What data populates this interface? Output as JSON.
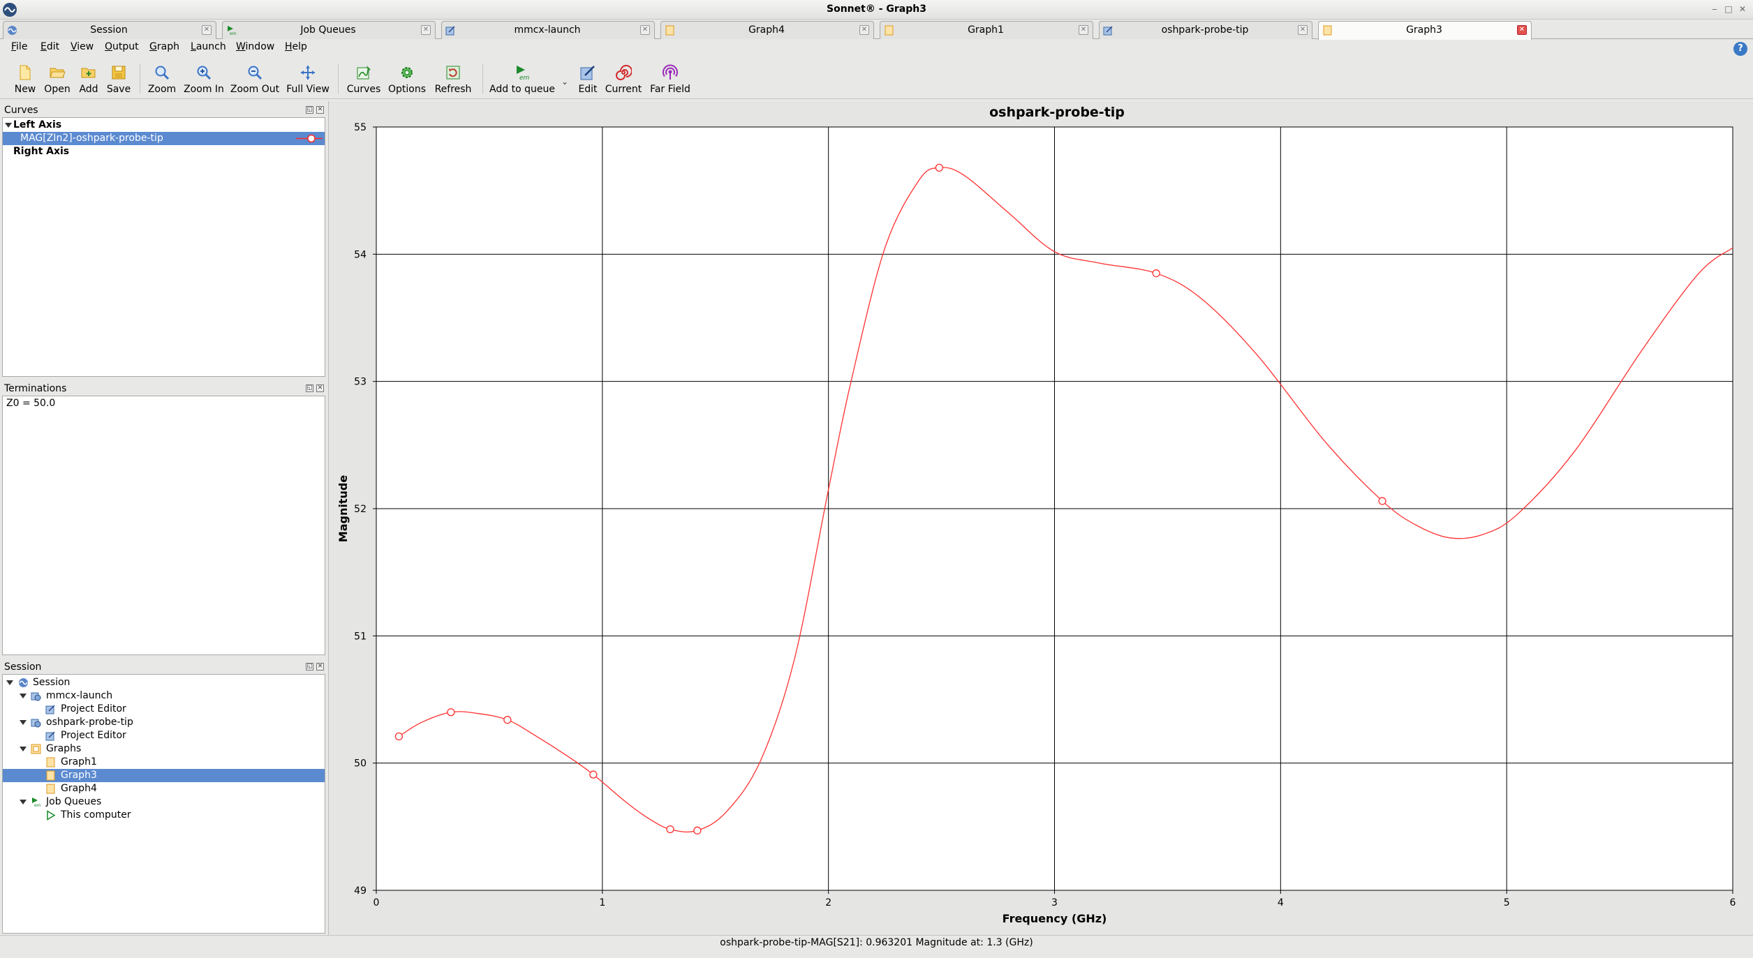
{
  "window": {
    "title": "Sonnet® - Graph3"
  },
  "tabs": [
    {
      "label": "Session",
      "icon": "session-icon",
      "active": false
    },
    {
      "label": "Job Queues",
      "icon": "em-icon",
      "active": false
    },
    {
      "label": "mmcx-launch",
      "icon": "project-icon",
      "active": false
    },
    {
      "label": "Graph4",
      "icon": "graph-icon",
      "active": false
    },
    {
      "label": "Graph1",
      "icon": "graph-icon",
      "active": false
    },
    {
      "label": "oshpark-probe-tip",
      "icon": "project-icon",
      "active": false
    },
    {
      "label": "Graph3",
      "icon": "graph-icon",
      "active": true
    }
  ],
  "menu": [
    "File",
    "Edit",
    "View",
    "Output",
    "Graph",
    "Launch",
    "Window",
    "Help"
  ],
  "toolbar": {
    "new": "New",
    "open": "Open",
    "add": "Add",
    "save": "Save",
    "zoom": "Zoom",
    "zoom_in": "Zoom In",
    "zoom_out": "Zoom Out",
    "full_view": "Full View",
    "curves": "Curves",
    "options": "Options",
    "refresh": "Refresh",
    "add_to_queue": "Add to queue",
    "edit": "Edit",
    "current": "Current",
    "far_field": "Far Field"
  },
  "curves_panel": {
    "title": "Curves",
    "left_axis": "Left Axis",
    "curve_item": "MAG[ZIn2]-oshpark-probe-tip",
    "right_axis": "Right Axis"
  },
  "terminations_panel": {
    "title": "Terminations",
    "value": "Z0 = 50.0"
  },
  "session_panel": {
    "title": "Session",
    "items": {
      "session": "Session",
      "mmcx_launch": "mmcx-launch",
      "mmcx_editor": "Project Editor",
      "oshpark": "oshpark-probe-tip",
      "oshpark_editor": "Project Editor",
      "graphs": "Graphs",
      "graph1": "Graph1",
      "graph3": "Graph3",
      "graph4": "Graph4",
      "job_queues": "Job Queues",
      "this_computer": "This computer"
    }
  },
  "status": {
    "text": "oshpark-probe-tip-MAG[S21]: 0.963201 Magnitude at: 1.3 (GHz)"
  },
  "chart_data": {
    "type": "line",
    "title": "oshpark-probe-tip",
    "xlabel": "Frequency (GHz)",
    "ylabel": "Magnitude",
    "xlim": [
      0,
      6
    ],
    "ylim": [
      49,
      55
    ],
    "xticks": [
      0,
      1,
      2,
      3,
      4,
      5,
      6
    ],
    "yticks": [
      49,
      50,
      51,
      52,
      53,
      54,
      55
    ],
    "grid": true,
    "series": [
      {
        "color": "#ff3030",
        "x": [
          0.1,
          0.2,
          0.33,
          0.45,
          0.58,
          0.7,
          0.85,
          0.96,
          1.1,
          1.2,
          1.3,
          1.42,
          1.55,
          1.7,
          1.85,
          2.0,
          2.1,
          2.25,
          2.4,
          2.49,
          2.6,
          2.8,
          3.0,
          3.2,
          3.45,
          3.65,
          3.9,
          4.2,
          4.45,
          4.6,
          4.75,
          4.9,
          5.05,
          5.3,
          5.6,
          5.85,
          6.0
        ],
        "y": [
          50.21,
          50.32,
          50.4,
          50.39,
          50.34,
          50.22,
          50.05,
          49.91,
          49.7,
          49.57,
          49.48,
          49.47,
          49.62,
          50.02,
          50.82,
          52.15,
          53.0,
          54.05,
          54.58,
          54.68,
          54.62,
          54.32,
          54.02,
          53.93,
          53.85,
          53.65,
          53.2,
          52.52,
          52.06,
          51.87,
          51.77,
          51.8,
          51.96,
          52.45,
          53.25,
          53.85,
          54.05
        ]
      }
    ],
    "markers": [
      {
        "x": 0.1,
        "y": 50.21
      },
      {
        "x": 0.33,
        "y": 50.4
      },
      {
        "x": 0.58,
        "y": 50.34
      },
      {
        "x": 0.96,
        "y": 49.91
      },
      {
        "x": 1.3,
        "y": 49.48
      },
      {
        "x": 1.42,
        "y": 49.47
      },
      {
        "x": 2.49,
        "y": 54.68
      },
      {
        "x": 3.45,
        "y": 53.85
      },
      {
        "x": 4.45,
        "y": 52.06
      }
    ]
  }
}
